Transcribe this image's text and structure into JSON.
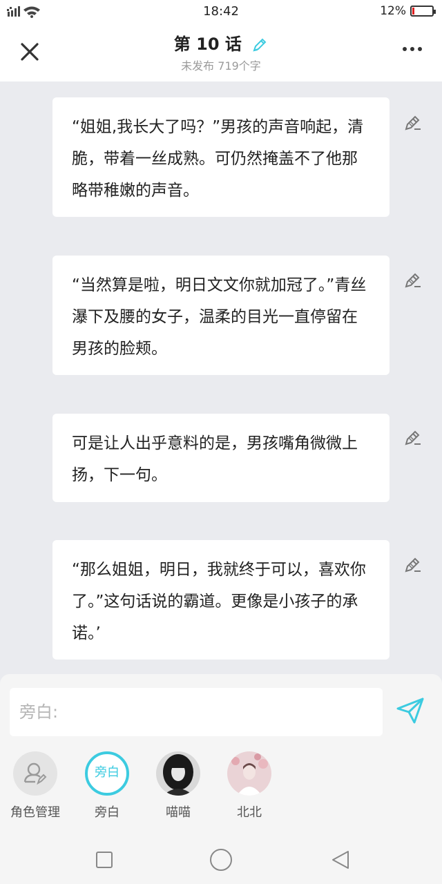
{
  "status": {
    "time": "18:42",
    "battery": "12%",
    "battery_level": 0.12
  },
  "header": {
    "title": "第 10 话",
    "subtitle": "未发布 719个字"
  },
  "paragraphs": [
    "“姐姐,我长大了吗？”男孩的声音响起，清脆，带着一丝成熟。可仍然掩盖不了他那略带稚嫩的声音。",
    "“当然算是啦，明日文文你就加冠了。”青丝瀑下及腰的女子，温柔的目光一直停留在男孩的脸颊。",
    "可是让人出乎意料的是，男孩嘴角微微上扬，下一句。",
    "“那么姐姐，明日，我就终于可以，喜欢你了。”这句话说的霸道。更像是小孩子的承诺。’"
  ],
  "composer": {
    "placeholder": "旁白:"
  },
  "roles": [
    {
      "label": "角色管理",
      "icon": "person-edit-icon"
    },
    {
      "label": "旁白",
      "avatar_text": "旁白",
      "selected": true
    },
    {
      "label": "喵喵",
      "avatar": "dark-photo"
    },
    {
      "label": "北北",
      "avatar": "pink-photo"
    }
  ],
  "colors": {
    "accent": "#3ccbe0",
    "background": "#eaebef",
    "battery_low": "#e02020"
  }
}
